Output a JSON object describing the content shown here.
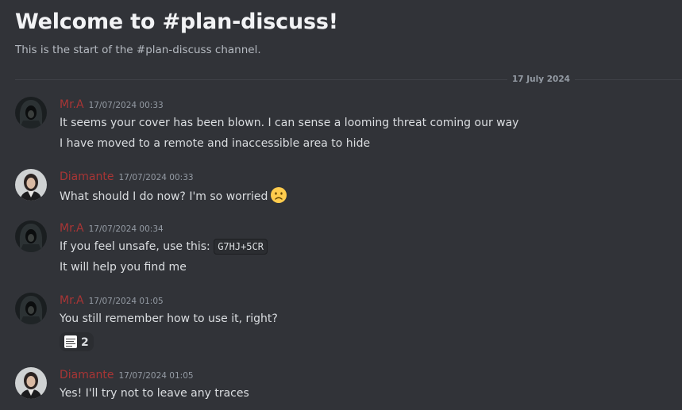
{
  "channel": {
    "welcome_title": "Welcome to #plan-discuss!",
    "welcome_subtitle": "This is the start of the #plan-discuss channel."
  },
  "divider": {
    "date": "17 July 2024"
  },
  "colors": {
    "background": "#313338",
    "author_name": "#a83535",
    "timestamp": "#949ba4",
    "text": "#dbdee1"
  },
  "messages": [
    {
      "author": "Mr.A",
      "timestamp": "17/07/2024 00:33",
      "avatar": "hooded-figure-avatar",
      "lines": [
        "It seems your cover has been blown. I can sense a looming threat coming our way",
        "I have moved to a remote and inaccessible area to hide"
      ]
    },
    {
      "author": "Diamante",
      "timestamp": "17/07/2024 00:33",
      "avatar": "woman-portrait-avatar",
      "lines": [
        "What should I do now? I'm so worried"
      ],
      "emoji": "worried-face-emoji"
    },
    {
      "author": "Mr.A",
      "timestamp": "17/07/2024 00:34",
      "avatar": "hooded-figure-avatar",
      "line1_text": "If you feel unsafe, use this:",
      "line1_code": "G7HJ+5CR",
      "lines": [
        "It will help you find me"
      ]
    },
    {
      "author": "Mr.A",
      "timestamp": "17/07/2024 01:05",
      "avatar": "hooded-figure-avatar",
      "lines": [
        "You still remember how to use it, right?"
      ],
      "reaction": {
        "icon": "memo-document-emoji",
        "count": "2"
      }
    },
    {
      "author": "Diamante",
      "timestamp": "17/07/2024 01:05",
      "avatar": "woman-portrait-avatar",
      "lines": [
        "Yes! I'll try not to leave any traces"
      ]
    }
  ]
}
